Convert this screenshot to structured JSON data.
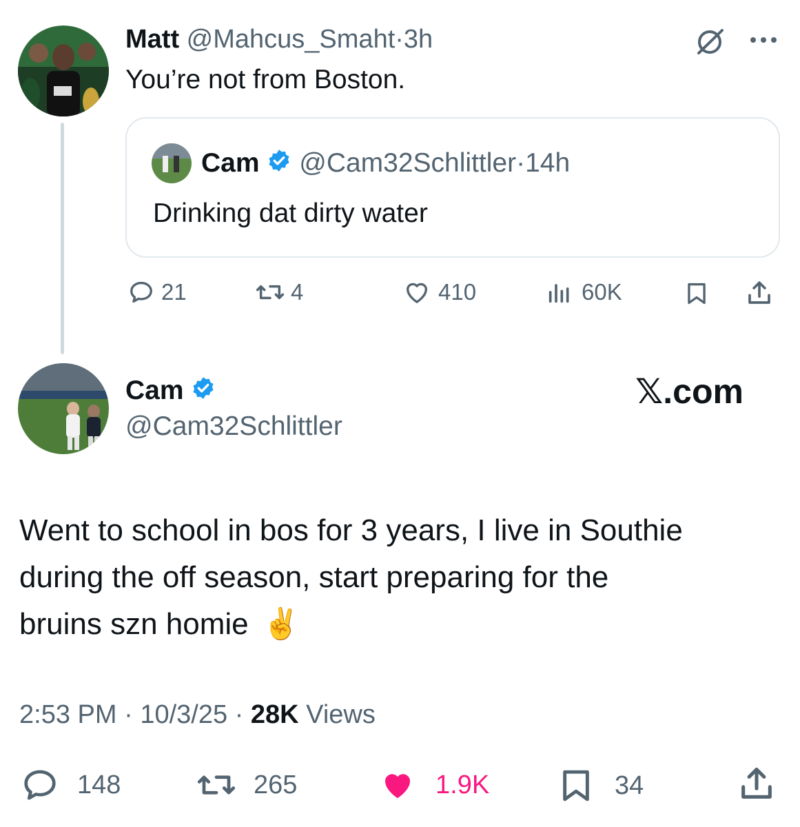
{
  "reply_tweet": {
    "author_name": "Matt",
    "handle": "@Mahcus_Smaht",
    "separator": "·",
    "time": "3h",
    "text": "You’re not from Boston.",
    "quoted": {
      "author_name": "Cam",
      "handle": "@Cam32Schlittler",
      "separator": "·",
      "time": "14h",
      "text": "Drinking dat dirty water"
    },
    "actions": {
      "replies": "21",
      "reposts": "4",
      "likes": "410",
      "views": "60K"
    }
  },
  "main_tweet": {
    "author_name": "Cam",
    "handle": "@Cam32Schlittler",
    "watermark": "𝕏.com",
    "text_line1": "Went to school in bos for 3 years, I live in Southie",
    "text_line2": "during the off season, start preparing for the",
    "text_line3": "bruins szn homie",
    "emoji": "✌️",
    "time": "2:53 PM",
    "date": "10/3/25",
    "sep": "·",
    "views_count": "28K",
    "views_label": "Views",
    "actions": {
      "replies": "148",
      "reposts": "265",
      "likes": "1.9K",
      "bookmarks": "34"
    }
  },
  "colors": {
    "verified": "#1d9bf0",
    "like_active": "#f91880",
    "muted": "#536471",
    "text": "#0f1419",
    "border": "#cfd9de"
  },
  "icons": [
    "grok-icon",
    "more-icon",
    "reply-icon",
    "repost-icon",
    "like-icon",
    "views-icon",
    "bookmark-icon",
    "share-icon",
    "verified-badge-icon"
  ]
}
